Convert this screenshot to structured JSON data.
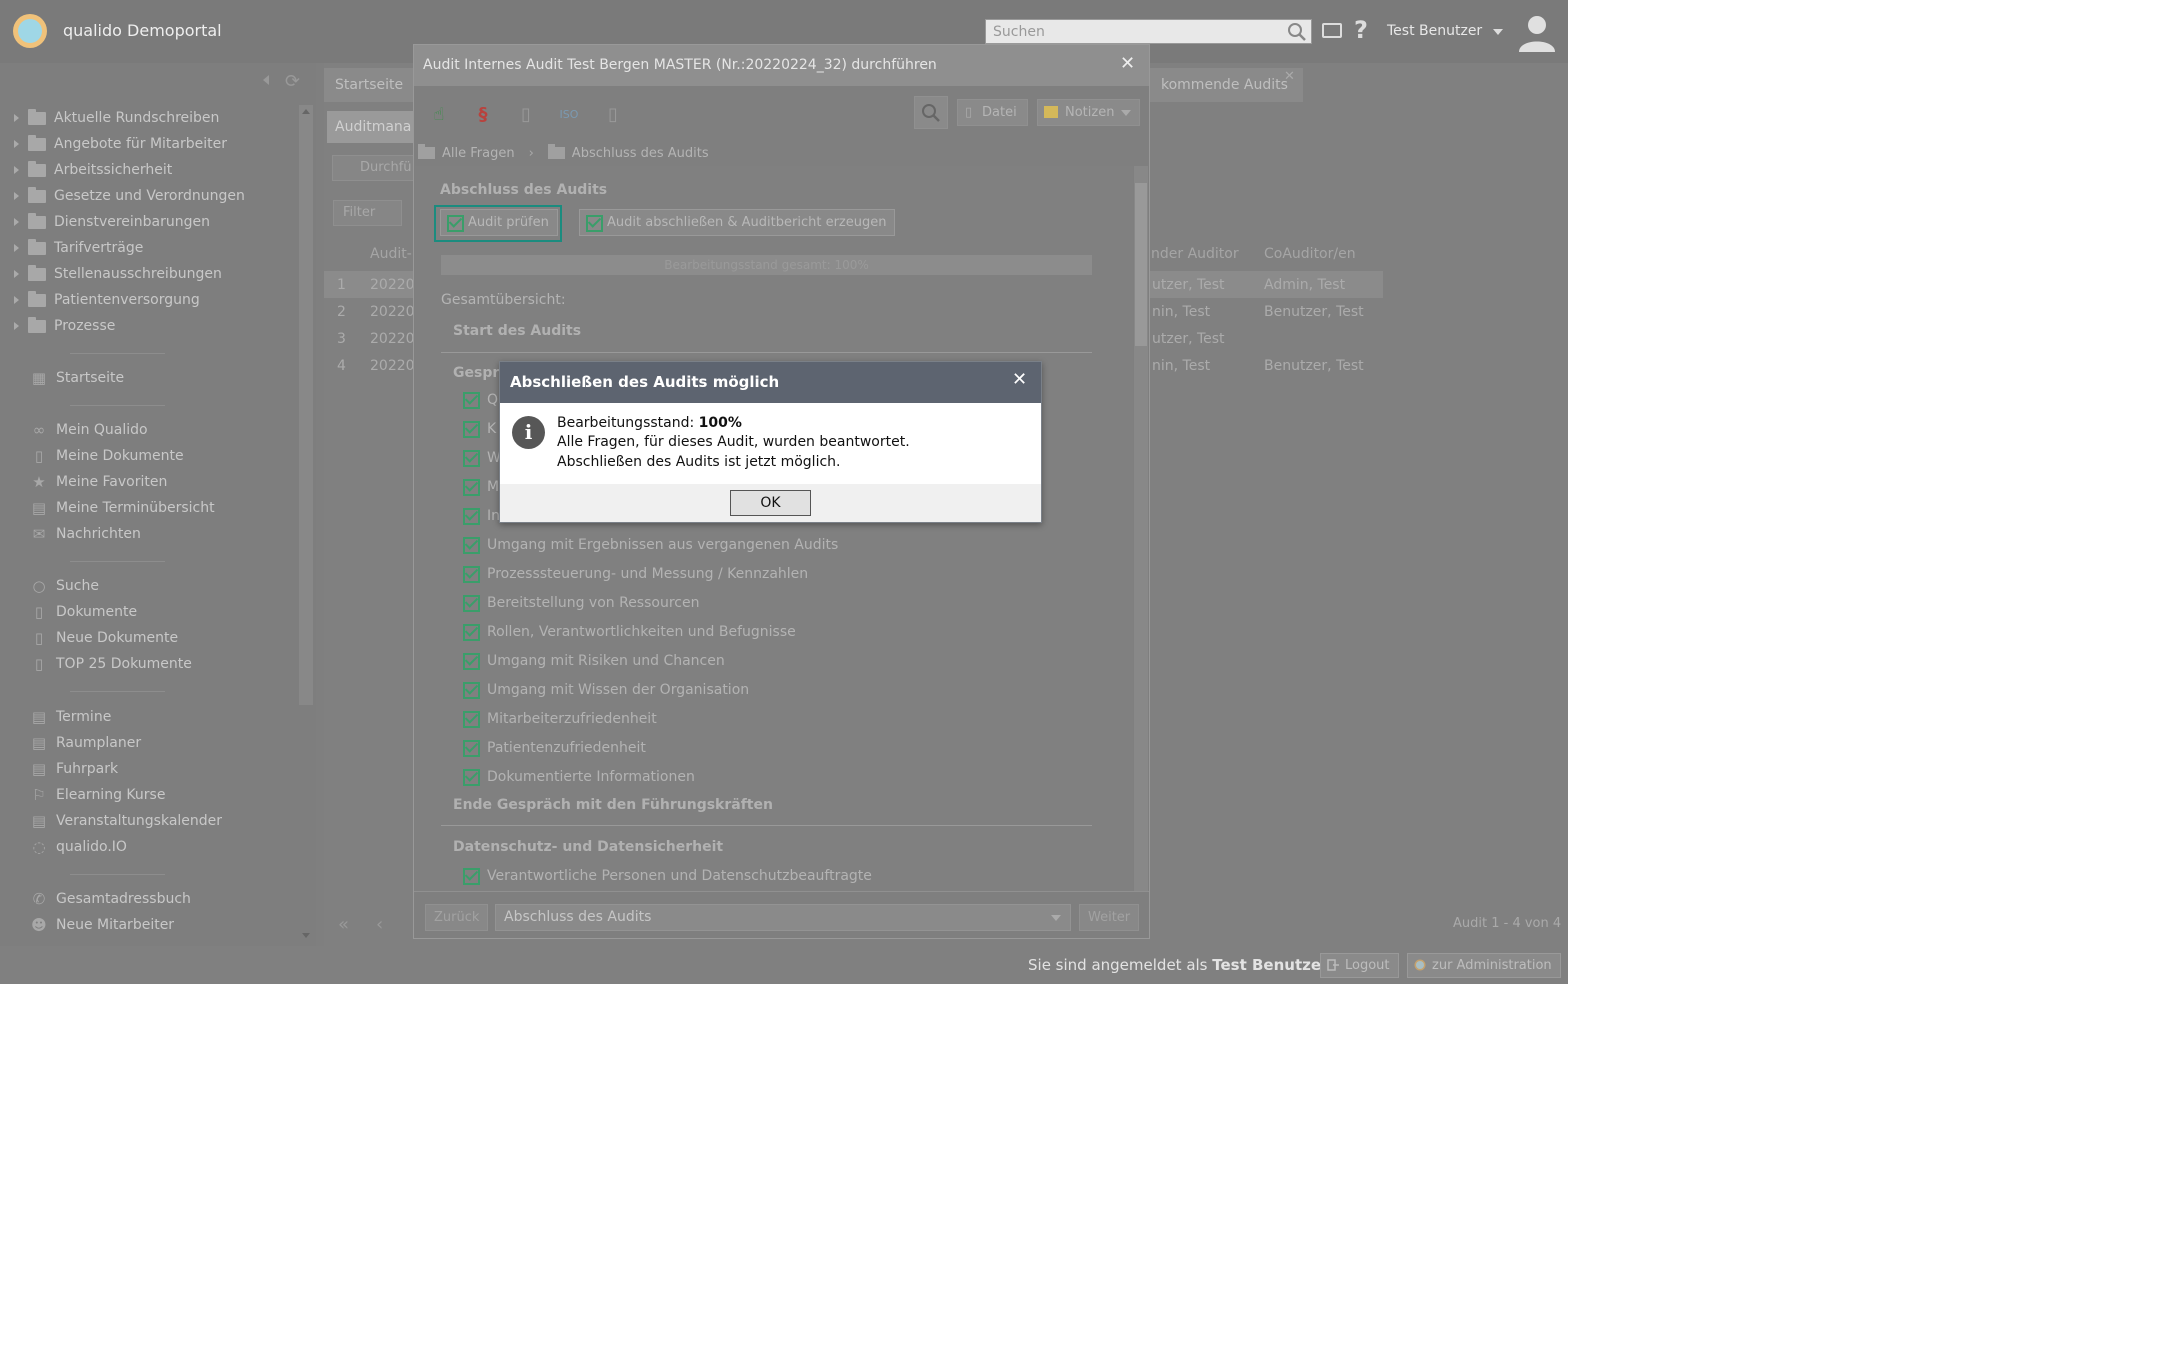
{
  "header": {
    "app_title": "qualido Demoportal",
    "search_placeholder": "Suchen",
    "help_label": "?",
    "user_name": "Test Benutzer"
  },
  "sidebar": {
    "folders": [
      "Aktuelle Rundschreiben",
      "Angebote für Mitarbeiter",
      "Arbeitssicherheit",
      "Gesetze und Verordnungen",
      "Dienstvereinbarungen",
      "Tarifverträge",
      "Stellenausschreibungen",
      "Patientenversorgung",
      "Prozesse"
    ],
    "nav": {
      "startseite": "Startseite",
      "mein_qualido": "Mein Qualido",
      "meine_dokumente": "Meine Dokumente",
      "meine_favoriten": "Meine Favoriten",
      "meine_terminuebersicht": "Meine Terminübersicht",
      "nachrichten": "Nachrichten",
      "suche": "Suche",
      "dokumente": "Dokumente",
      "neue_dokumente": "Neue Dokumente",
      "top25": "TOP 25 Dokumente",
      "termine": "Termine",
      "raumplaner": "Raumplaner",
      "fuhrpark": "Fuhrpark",
      "elearning": "Elearning Kurse",
      "veranstaltungskalender": "Veranstaltungskalender",
      "qualido_io": "qualido.IO",
      "gesamtadressbuch": "Gesamtadressbuch",
      "neue_mitarbeiter": "Neue Mitarbeiter"
    }
  },
  "background": {
    "tab_start": "Startseite",
    "tab_upcoming": "kommende Audits",
    "tab_auditmana": "Auditmana",
    "durchfu_btn": "Durchfü",
    "filter_btn": "Filter",
    "col_audit": "Audit-",
    "col_auditor": "nder Auditor",
    "col_coauditor": "CoAuditor/en",
    "rows": [
      {
        "num": "1",
        "date": "20220",
        "auditor": "utzer, Test",
        "coauditor": "Admin, Test"
      },
      {
        "num": "2",
        "date": "20220",
        "auditor": "nin, Test",
        "coauditor": "Benutzer, Test"
      },
      {
        "num": "3",
        "date": "20220",
        "auditor": "utzer, Test",
        "coauditor": ""
      },
      {
        "num": "4",
        "date": "20220",
        "auditor": "nin, Test",
        "coauditor": "Benutzer, Test"
      }
    ],
    "pager_info": "Audit 1 - 4 von 4"
  },
  "audit_modal": {
    "title": "Audit Internes Audit Test Bergen MASTER (Nr.:20220224_32) durchführen",
    "toolbar": {
      "datei": "Datei",
      "notizen": "Notizen"
    },
    "breadcrumb": [
      "Alle Fragen",
      "Abschluss des Audits"
    ],
    "section_title": "Abschluss des Audits",
    "btn_pruefen": "Audit prüfen",
    "btn_abschliessen": "Audit abschließen & Auditbericht erzeugen",
    "progress_label": "Bearbeitungsstand gesamt: 100%",
    "progress_value": 1.0,
    "overview_label": "Gesamtübersicht:",
    "start_section": "Start des Audits",
    "gespraech_partial": "Gesprä",
    "hidden_partial": [
      "Q",
      "K",
      "W",
      "M",
      "In"
    ],
    "questions": [
      "Umgang mit Ergebnissen aus vergangenen Audits",
      "Prozesssteuerung- und Messung / Kennzahlen",
      "Bereitstellung von Ressourcen",
      "Rollen, Verantwortlichkeiten und Befugnisse",
      "Umgang mit Risiken und Chancen",
      "Umgang mit Wissen der Organisation",
      "Mitarbeiterzufriedenheit",
      "Patientenzufriedenheit",
      "Dokumentierte Informationen"
    ],
    "end_section": "Ende Gespräch mit den Führungskräften",
    "datenschutz_section": "Datenschutz- und Datensicherheit",
    "datenschutz_item": "Verantwortliche Personen und Datenschutzbeauftragte",
    "footer": {
      "back": "Zurück",
      "select_value": "Abschluss des Audits",
      "next": "Weiter"
    }
  },
  "message_box": {
    "title": "Abschließen des Audits möglich",
    "line1_label": "Bearbeitungsstand: ",
    "line1_value": "100%",
    "line2": "Alle Fragen, für dieses Audit, wurden beantwortet.",
    "line3": "Abschließen des Audits ist jetzt möglich.",
    "ok": "OK"
  },
  "bottombar": {
    "logged_in_prefix": "Sie sind angemeldet als ",
    "logged_in_user": "Test Benutzer",
    "logout": "Logout",
    "admin": "zur Administration"
  },
  "colors": {
    "header_overlay": "#7a7a7a",
    "dialog_header": "#5d6470",
    "highlight_frame": "#1b8c7f",
    "check_green": "#3a9e6a"
  }
}
